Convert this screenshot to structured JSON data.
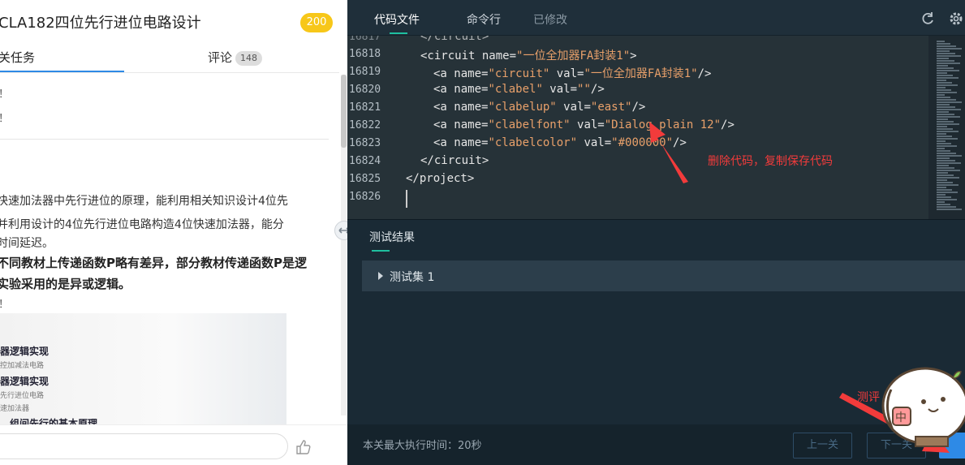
{
  "left_panel": {
    "task_title": "CLA182四位先行进位电路设计",
    "score": "200",
    "tabs": {
      "task": "关任务",
      "comment": "评论",
      "comment_count": "148"
    },
    "fragments": [
      "！",
      "！"
    ],
    "paragraph": [
      "快速加法器中先行进位的原理，能利用相关知识设计4位先",
      "并利用设计的4位先行进位电路构造4位快速加法器，能分",
      "时间延迟。"
    ],
    "note": [
      "不同教材上传递函数P略有差异，部分教材传递函数P是逻",
      "实验采用的是异或逻辑。"
    ],
    "fragment_after": "！",
    "slide": {
      "items": [
        {
          "head": "器逻辑实现",
          "sub": "控加减法电路"
        },
        {
          "head": "器逻辑实现",
          "sub": "先行进位电路"
        },
        {
          "sub": "速加法器"
        },
        {
          "head": "组间先行的基本原理"
        }
      ]
    }
  },
  "right_panel": {
    "tabs": [
      "代码文件",
      "命令行",
      "已修改"
    ],
    "code": {
      "top_partial": "</circuit>",
      "lines": [
        {
          "num": "16818",
          "text": "<circuit name=\"一位全加器FA封装1\">"
        },
        {
          "num": "16819",
          "text": "<a name=\"circuit\" val=\"一位全加器FA封装1\"/>"
        },
        {
          "num": "16820",
          "text": "<a name=\"clabel\" val=\"\"/>"
        },
        {
          "num": "16821",
          "text": "<a name=\"clabelup\" val=\"east\"/>"
        },
        {
          "num": "16822",
          "text": "<a name=\"clabelfont\" val=\"Dialog plain 12\"/>"
        },
        {
          "num": "16823",
          "text": "<a name=\"clabelcolor\" val=\"#000000\"/>"
        },
        {
          "num": "16824",
          "text": "</circuit>"
        },
        {
          "num": "16825",
          "text": "</project>"
        },
        {
          "num": "16826",
          "text": ""
        }
      ]
    },
    "results_title": "测试结果",
    "testset_label": "测试集 1",
    "footer": {
      "exec_time": "本关最大执行时间：20秒",
      "prev": "上一关",
      "next": "下一关"
    }
  },
  "annotations": {
    "delete_note": "删除代码，复制保存代码",
    "eval_note": "测评"
  },
  "colors": {
    "accent_green": "#1fbf9f",
    "accent_blue": "#2e8ae6",
    "badge_yellow": "#f7c719",
    "annotation_red": "#f23b3b"
  }
}
